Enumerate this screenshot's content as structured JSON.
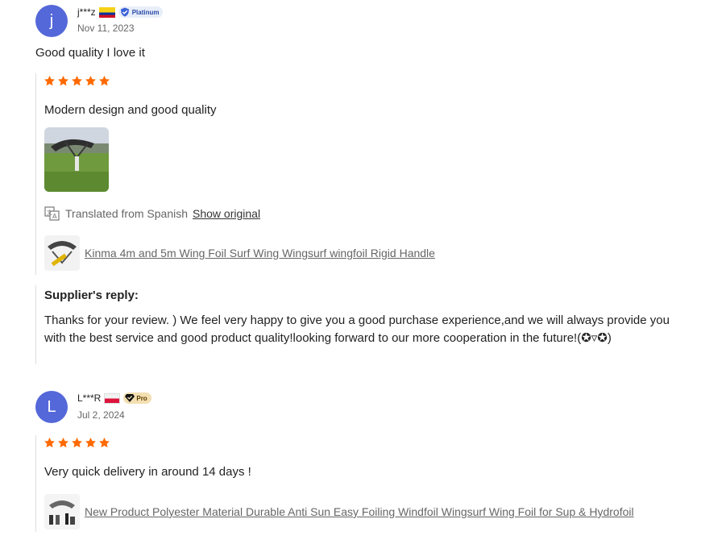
{
  "reviews": [
    {
      "avatar_letter": "j",
      "username": "j***z",
      "country_flag": "colombia-flag",
      "badge_label": "Platinum",
      "date": "Nov 11, 2023",
      "summary": "Good quality I love it",
      "rating": 5,
      "text": "Modern design and good quality",
      "translated_label": "Translated from Spanish",
      "show_original_label": "Show original",
      "product_title": "Kinma 4m and 5m Wing Foil Surf Wing Wingsurf wingfoil Rigid Handle",
      "supplier_reply_title": "Supplier's reply:",
      "supplier_reply_text": "Thanks for your review. ) We feel very happy to give you a good purchase experience,and we will always provide you with the best service and good product quality!looking forward to our more cooperation in the future!(✪▿✪)"
    },
    {
      "avatar_letter": "L",
      "username": "L***R",
      "country_flag": "poland-flag",
      "badge_label": "Pro",
      "date": "Jul 2, 2024",
      "rating": 5,
      "text": "Very quick delivery in around 14 days !",
      "product_title": "New Product Polyester Material Durable Anti Sun Easy Foiling Windfoil Wingsurf Wing Foil for Sup & Hydrofoil"
    }
  ],
  "colors": {
    "star": "#ff6a00",
    "avatar": "#5468d9",
    "link": "#666666"
  }
}
